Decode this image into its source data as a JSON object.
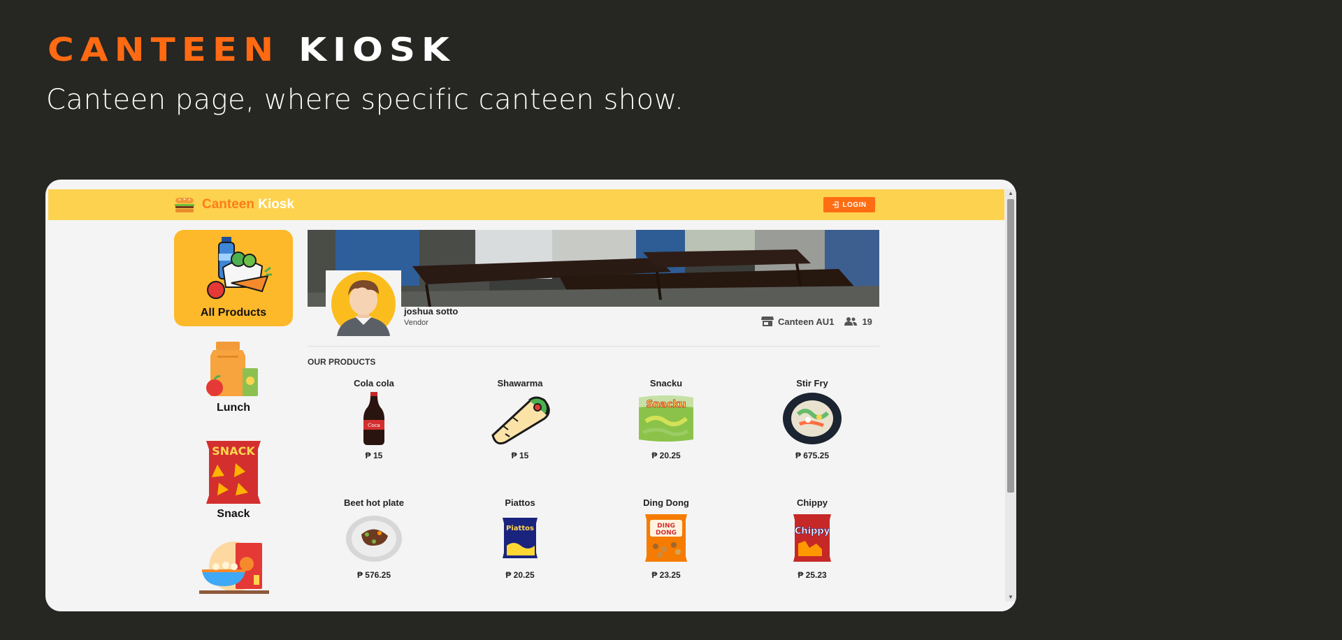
{
  "hero": {
    "title_part1": "CANTEEN",
    "title_part2": "KIOSK",
    "subtitle": "Canteen page, where specific canteen show."
  },
  "app": {
    "brand_part1": "Canteen",
    "brand_part2": "Kiosk",
    "login_label": "LOGIN"
  },
  "sidebar": {
    "items": [
      {
        "label": "All Products",
        "icon": "grocery-icon",
        "active": true
      },
      {
        "label": "Lunch",
        "icon": "lunch-bag-icon",
        "active": false
      },
      {
        "label": "Snack",
        "icon": "snack-bag-icon",
        "active": false
      },
      {
        "label": "",
        "icon": "breakfast-bowl-icon",
        "active": false
      }
    ]
  },
  "vendor": {
    "name": "joshua sotto",
    "role": "Vendor",
    "canteen": "Canteen AU1",
    "followers": "19"
  },
  "products_section": {
    "title": "OUR PRODUCTS",
    "items": [
      {
        "name": "Cola cola",
        "price": "₱ 15",
        "icon": "cola-bottle-icon"
      },
      {
        "name": "Shawarma",
        "price": "₱ 15",
        "icon": "shawarma-icon"
      },
      {
        "name": "Snacku",
        "price": "₱ 20.25",
        "icon": "snack-pack-icon"
      },
      {
        "name": "Stir Fry",
        "price": "₱ 675.25",
        "icon": "stir-fry-plate-icon"
      },
      {
        "name": "Beet hot plate",
        "price": "₱ 576.25",
        "icon": "hot-plate-icon"
      },
      {
        "name": "Piattos",
        "price": "₱ 20.25",
        "icon": "chips-bag-icon"
      },
      {
        "name": "Ding Dong",
        "price": "₱ 23.25",
        "icon": "nuts-bag-icon"
      },
      {
        "name": "Chippy",
        "price": "₱ 25.23",
        "icon": "chips-bag-icon"
      }
    ]
  },
  "colors": {
    "background": "#262622",
    "accent": "#ff6a13",
    "appbar": "#fdd24e",
    "active_category": "#fdb92a"
  }
}
